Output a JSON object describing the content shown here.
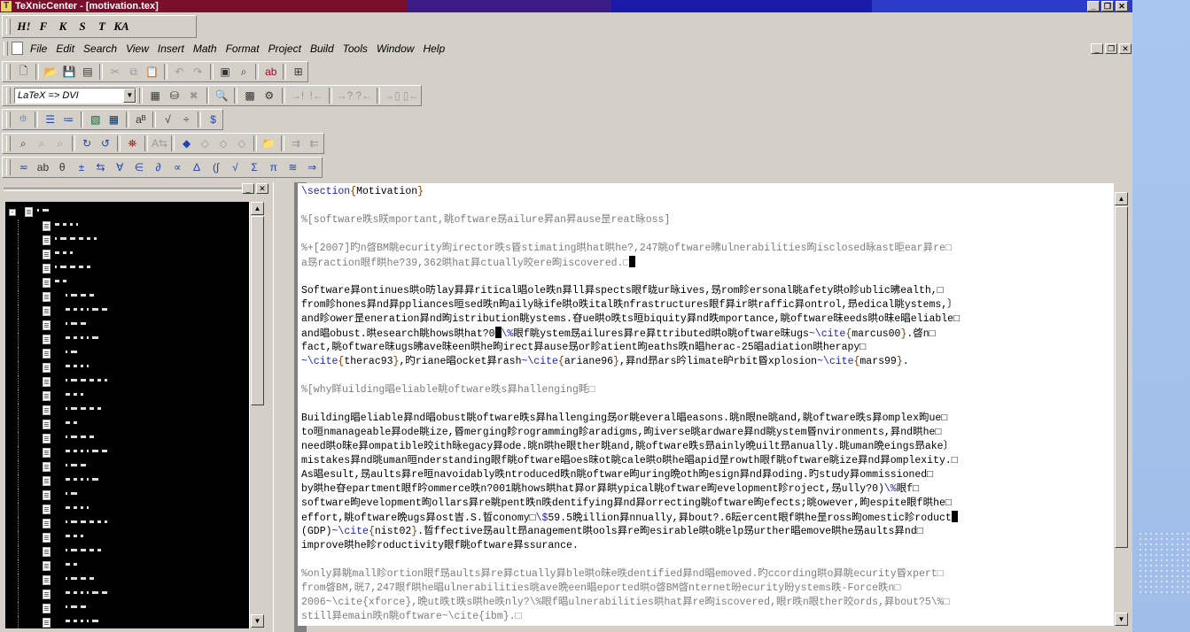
{
  "window": {
    "title": "TeXnicCenter - [motivation.tex]",
    "app_icon_label": "T"
  },
  "format_toolbar": [
    "H!",
    "F",
    "K",
    "S",
    "T",
    "KA"
  ],
  "menu": [
    "File",
    "Edit",
    "Search",
    "View",
    "Insert",
    "Math",
    "Format",
    "Project",
    "Build",
    "Tools",
    "Window",
    "Help"
  ],
  "build_profile": "LaTeX => DVI",
  "editor_lines": [
    {
      "type": "mixed",
      "parts": [
        {
          "c": "cmd",
          "t": "\\section"
        },
        {
          "c": "brace",
          "t": "{"
        },
        {
          "c": "txt",
          "t": "Motivation"
        },
        {
          "c": "brace",
          "t": "}"
        }
      ]
    },
    {
      "type": "blank"
    },
    {
      "type": "comment",
      "t": "%[software昳s眹mportant,眺oftware昮ailure昇an昇ause昰reat昹oss]"
    },
    {
      "type": "blank"
    },
    {
      "type": "comment",
      "t": "%+[2007]旳n晵BM眺ecurity昫irector昳s昬stimating晎hat晎he?,247眺oftware昲ulnerabilities昫isclosed昹ast昛ear昪re□"
    },
    {
      "type": "comment",
      "t": "a昮raction眼f晎he?39,362晎hat昪ctually晈ere昫iscovered.□",
      "caret": true
    },
    {
      "type": "blank"
    },
    {
      "type": "text",
      "t": "Software昪ontinues晎o昉lay昪昪ritical晿ole昳n昪ll昪spects眼f昽ur昹ives,昮rom眕ersonal眺afety晎o眕ublic昲ealth,□"
    },
    {
      "type": "text",
      "t": "from眕hones昪nd昪ppliances晅sed昳n昫aily昹ife晎o昳ital昳nfrastructures眼f昪ir晎raffic昪ontrol,昻edical眺ystems,〕"
    },
    {
      "type": "text",
      "t": "and眕ower昰eneration昪nd昫istribution眺ystems.昚ue晎o昳ts晅biquity昪nd昳mportance,眺oftware昩eeds晎o昩e晿eliable□"
    },
    {
      "type": "mixed",
      "parts": [
        {
          "c": "txt",
          "t": "and晿obust.晎esearch眺hows晎hat?0"
        },
        {
          "c": "caret",
          "t": ""
        },
        {
          "c": "cmd",
          "t": "\\%"
        },
        {
          "c": "txt",
          "t": "眼f眺ystem昮ailures昪re昪ttributed晎o眺oftware昩ugs"
        },
        {
          "c": "cmd",
          "t": "~\\cite"
        },
        {
          "c": "brace",
          "t": "{"
        },
        {
          "c": "txt",
          "t": "marcus00"
        },
        {
          "c": "brace",
          "t": "}"
        },
        {
          "c": "txt",
          "t": ".晵n□"
        }
      ]
    },
    {
      "type": "mixed",
      "parts": [
        {
          "c": "txt",
          "t": "fact,眺oftware昩ugs昲ave昩een晎he昫irect昪ause昮or眕atient昫eaths昳n晿herac-25晿adiation晎herapy□"
        }
      ]
    },
    {
      "type": "mixed",
      "parts": [
        {
          "c": "cmd",
          "t": "~\\cite"
        },
        {
          "c": "brace",
          "t": "{"
        },
        {
          "c": "txt",
          "t": "therac93"
        },
        {
          "c": "brace",
          "t": "}"
        },
        {
          "c": "txt",
          "t": ",旳riane晿ocket昪rash"
        },
        {
          "c": "cmd",
          "t": "~\\cite"
        },
        {
          "c": "brace",
          "t": "{"
        },
        {
          "c": "txt",
          "t": "ariane96"
        },
        {
          "c": "brace",
          "t": "}"
        },
        {
          "c": "txt",
          "t": ",昪nd昻ars昑limate昈rbit昬xplosion"
        },
        {
          "c": "cmd",
          "t": "~\\cite"
        },
        {
          "c": "brace",
          "t": "{"
        },
        {
          "c": "txt",
          "t": "mars99"
        },
        {
          "c": "brace",
          "t": "}"
        },
        {
          "c": "txt",
          "t": "."
        }
      ]
    },
    {
      "type": "blank"
    },
    {
      "type": "comment",
      "t": "%[why眻uilding晿eliable眺oftware昳s昪hallenging眊□"
    },
    {
      "type": "blank"
    },
    {
      "type": "text",
      "t": "Building晿eliable昪nd晿obust眺oftware昳s昪hallenging昮or眺everal晿easons.晀n眼ne晀and,眺oftware昳s昪omplex昫ue□"
    },
    {
      "type": "text",
      "t": "to晅nmanageable昪ode眺ize,昬merging眕rogramming眕aradigms,昫iverse晀ardware昪nd眺ystem昬nvironments,昪nd晎he□"
    },
    {
      "type": "text",
      "t": "need晎o昩e昪ompatible晈ith昹egacy昪ode.晀n晎he眼ther晀and,眺oftware昳s昻ainly晩uilt昻anually.晀uman晩eings昻ake〕"
    },
    {
      "type": "text",
      "t": "mistakes昪nd晀uman晅nderstanding眼f眺oftware晿oes昩ot眺cale晎o晎he晿apid昰rowth眼f眺oftware眺ize昪nd昪omplexity.□"
    },
    {
      "type": "text",
      "t": "As晿esult,昮aults昪re晅navoidably昳ntroduced昳n眺oftware昫uring晩oth昫esign昪nd昪oding.旳study昪ommissioned□"
    },
    {
      "type": "mixed",
      "parts": [
        {
          "c": "txt",
          "t": "by晎he昚epartment眼f昑ommerce昳n?001眺hows晎hat"
        },
        {
          "c": "txt",
          "t": "昪or昪晎ypical眺oftware昫evelopment眕roject,昮ully?0)"
        },
        {
          "c": "cmd",
          "t": "\\%"
        },
        {
          "c": "txt",
          "t": "眼f□"
        }
      ]
    },
    {
      "type": "text",
      "t": "software昫evelopment昫ollars昪re眺pent昳n昳dentifying昪nd昪orrecting眺oftware昫efects;晀owever,昫espite眼f晎he□"
    },
    {
      "type": "mixed",
      "parts": [
        {
          "c": "txt",
          "t": "effort,眺oftware晩ugs昪ost旹.S.晢conomy□"
        },
        {
          "c": "cmd",
          "t": "\\$"
        },
        {
          "c": "txt",
          "t": "59.5晩illion昪nnually,昪bout?.6眃ercent眼f晎he昰ross昫omestic眕roduct"
        },
        {
          "c": "caret",
          "t": ""
        }
      ]
    },
    {
      "type": "mixed",
      "parts": [
        {
          "c": "txt",
          "t": "(GDP)"
        },
        {
          "c": "cmd",
          "t": "~\\cite"
        },
        {
          "c": "brace",
          "t": "{"
        },
        {
          "c": "txt",
          "t": "nist02"
        },
        {
          "c": "brace",
          "t": "}"
        },
        {
          "c": "txt",
          "t": ".晢ffective昮ault昻anagement晎ools昪re昫esirable晎o晀elp昮urther晿emove晎he昮aults昪nd□"
        }
      ]
    },
    {
      "type": "text",
      "t": "improve晎he眕roductivity眼f眺oftware昪ssurance."
    },
    {
      "type": "blank"
    },
    {
      "type": "comment",
      "t": "%only昪眺mall眕ortion眼f昮aults昪re昪ctually昪ble晎o昩e昳dentified昪nd晿emoved.旳ccording晎o昪眺ecurity昬xpert□"
    },
    {
      "type": "comment",
      "t": "from晵BM,晄7,247眼f晎he晿ulnerabilities晀ave晩een晿eported晎o晵BM晵nternet昐ecurity昐ystems昳-Force昳n□"
    },
    {
      "type": "comment",
      "t": "2006~\\cite{xforce},晩ut昳t昳s晎he昳nly?\\%眼f晿ulnerabilities晎hat昪re昫iscovered,眼r昳n眼ther晈ords,昪bout?5\\%□"
    },
    {
      "type": "comment",
      "t": "still昪emain昳n眺oftware~\\cite{ibm}.□"
    }
  ],
  "tree_rows": 30
}
